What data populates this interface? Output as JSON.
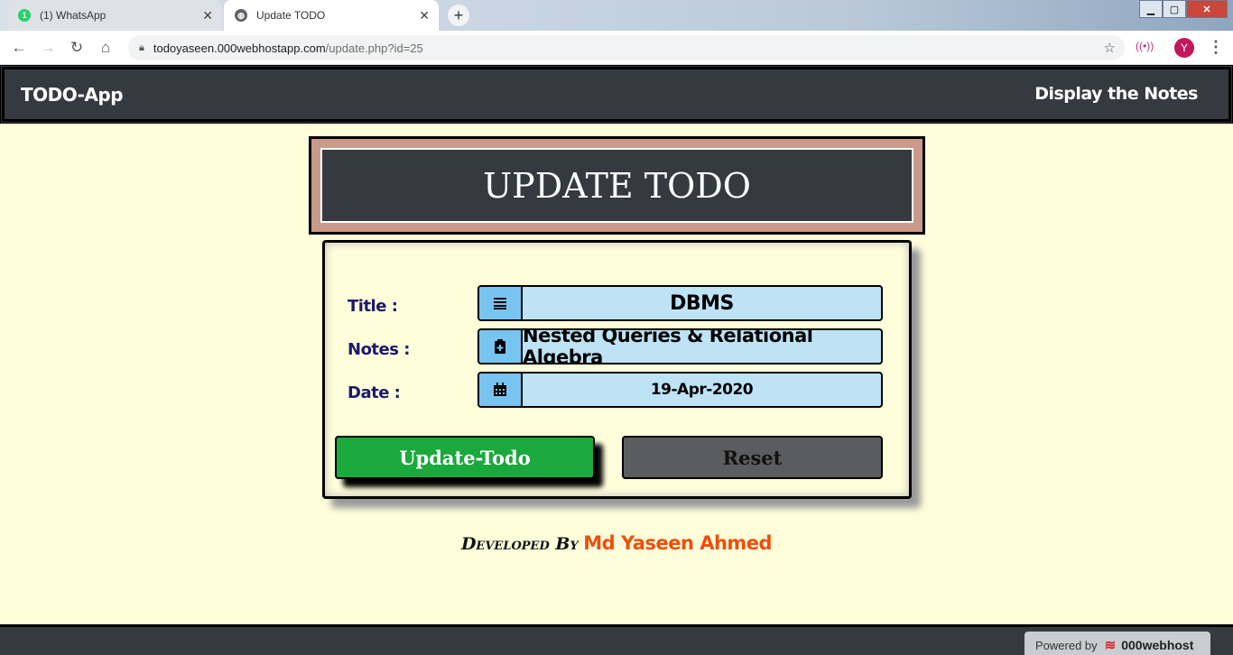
{
  "browser": {
    "tabs": [
      {
        "title": "(1) WhatsApp",
        "badge": "1",
        "active": false
      },
      {
        "title": "Update TODO",
        "active": true
      }
    ],
    "url_host": "todoyaseen.000webhostapp.com",
    "url_path": "/update.php?id=25",
    "profile_initial": "Y"
  },
  "navbar": {
    "brand": "TODO-App",
    "link": "Display the Notes"
  },
  "page": {
    "heading": "UPDATE TODO"
  },
  "form": {
    "title_label": "Title :",
    "title_value": "DBMS",
    "notes_label": "Notes :",
    "notes_value": "Nested Queries & Relational Algebra",
    "date_label": "Date :",
    "date_value": "19-Apr-2020",
    "submit_label": "Update-Todo",
    "reset_label": "Reset"
  },
  "credit": {
    "prefix": "Developed By",
    "author": "Md Yaseen Ahmed"
  },
  "footer": {
    "powered_by": "Powered by",
    "host_name": "000webhost"
  },
  "colors": {
    "page_bg": "#fffedb",
    "navbar_bg": "#343a40",
    "field_bg": "#bde3f5",
    "icon_bg": "#78c4f0",
    "update_btn": "#1ba83d",
    "reset_btn": "#5b5c5e",
    "author_color": "#f04e0c"
  }
}
